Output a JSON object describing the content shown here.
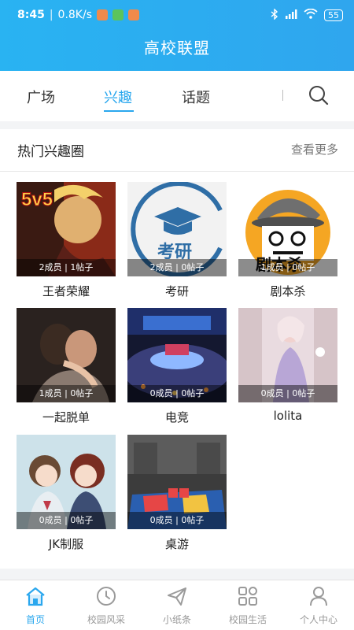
{
  "status_bar": {
    "time": "8:45",
    "speed": "0.8K/s",
    "battery": "55"
  },
  "app": {
    "title": "高校联盟"
  },
  "tabs": [
    {
      "label": "广场",
      "active": false
    },
    {
      "label": "兴趣",
      "active": true
    },
    {
      "label": "话题",
      "active": false
    }
  ],
  "section": {
    "title": "热门兴趣圈",
    "see_more": "查看更多"
  },
  "groups": [
    {
      "name": "王者荣耀",
      "stats": "2成员 | 1帖子",
      "image_text": "5v5"
    },
    {
      "name": "考研",
      "stats": "2成员 | 0帖子",
      "image_text": "考研"
    },
    {
      "name": "剧本杀",
      "stats": "1成员 | 0帖子",
      "image_text": "剧本杀"
    },
    {
      "name": "一起脱单",
      "stats": "1成员 | 0帖子"
    },
    {
      "name": "电竞",
      "stats": "0成员 | 0帖子"
    },
    {
      "name": "lolita",
      "stats": "0成员 | 0帖子"
    },
    {
      "name": "JK制服",
      "stats": "0成员 | 0帖子"
    },
    {
      "name": "桌游",
      "stats": "0成员 | 0帖子"
    }
  ],
  "bottom_nav": [
    {
      "label": "首页",
      "icon": "home-icon",
      "active": true
    },
    {
      "label": "校园风采",
      "icon": "campus-style-icon",
      "active": false
    },
    {
      "label": "小纸条",
      "icon": "paper-plane-icon",
      "active": false
    },
    {
      "label": "校园生活",
      "icon": "grid-icon",
      "active": false
    },
    {
      "label": "个人中心",
      "icon": "person-icon",
      "active": false
    }
  ],
  "colors": {
    "accent": "#2aa7ee",
    "header": "#29b3f2",
    "text": "#222222",
    "muted": "#999999"
  }
}
